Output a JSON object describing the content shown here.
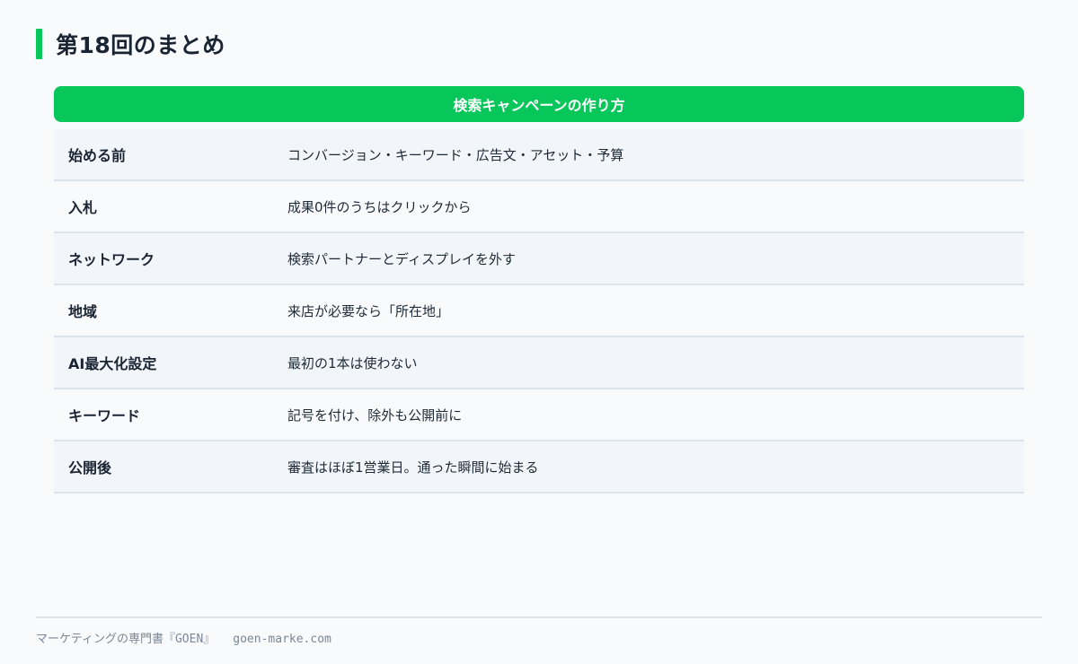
{
  "title": "第18回のまとめ",
  "table": {
    "header": "検索キャンペーンの作り方",
    "rows": [
      {
        "key": "始める前",
        "value": "コンバージョン・キーワード・広告文・アセット・予算"
      },
      {
        "key": "入札",
        "value": "成果0件のうちはクリックから"
      },
      {
        "key": "ネットワーク",
        "value": "検索パートナーとディスプレイを外す"
      },
      {
        "key": "地域",
        "value": "来店が必要なら「所在地」"
      },
      {
        "key": "AI最大化設定",
        "value": "最初の1本は使わない"
      },
      {
        "key": "キーワード",
        "value": "記号を付け、除外も公開前に"
      },
      {
        "key": "公開後",
        "value": "審査はほぼ1営業日。通った瞬間に始まる"
      }
    ]
  },
  "footer": {
    "brand": "マーケティングの専門書『GOEN』",
    "site": "goen-marke.com"
  },
  "colors": {
    "accent": "#07c65a",
    "text": "#1a2433",
    "row_odd": "#f2f5f9",
    "row_even": "#f9fafc"
  }
}
